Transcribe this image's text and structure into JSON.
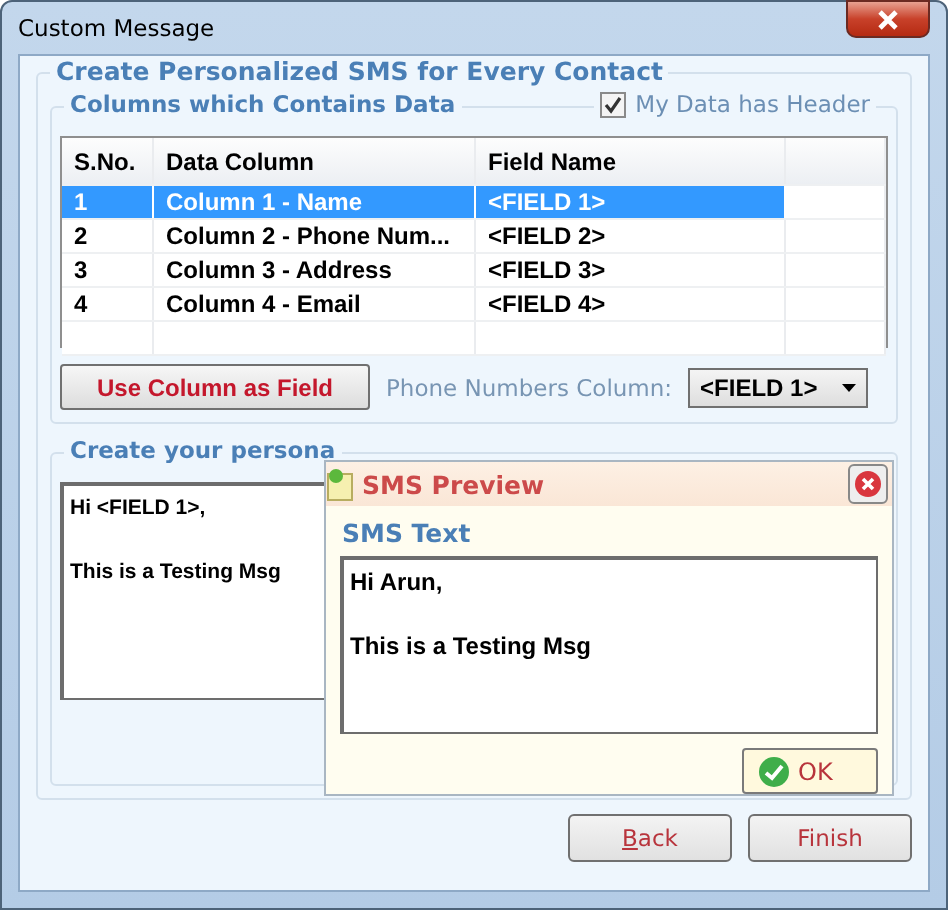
{
  "window": {
    "title": "Custom Message"
  },
  "main_group": {
    "title": "Create Personalized SMS for Every Contact"
  },
  "columns_group": {
    "title": "Columns which Contains Data",
    "header_checkbox": {
      "label": "My Data has Header",
      "checked": true
    }
  },
  "table": {
    "columns": [
      "S.No.",
      "Data Column",
      "Field Name"
    ],
    "rows": [
      {
        "cells": [
          "1",
          "Column 1 - Name",
          "<FIELD 1>"
        ],
        "selected": true
      },
      {
        "cells": [
          "2",
          "Column 2 - Phone Num...",
          "<FIELD 2>"
        ],
        "selected": false
      },
      {
        "cells": [
          "3",
          "Column 3 - Address",
          "<FIELD 3>"
        ],
        "selected": false
      },
      {
        "cells": [
          "4",
          "Column 4 - Email",
          "<FIELD 4>"
        ],
        "selected": false
      }
    ]
  },
  "use_column_button": "Use Column as Field",
  "phone_column": {
    "label": "Phone Numbers Column:",
    "value": "<FIELD 1>"
  },
  "message_group": {
    "title": "Create your persona",
    "text": "Hi <FIELD 1>,\n\nThis is a Testing Msg"
  },
  "preview": {
    "title": "SMS Preview",
    "label": "SMS Text",
    "text": "Hi Arun,\n\nThis is a Testing Msg",
    "ok": "OK"
  },
  "buttons": [
    {
      "label": "Back",
      "first_letter_underlined": true
    },
    {
      "label": "Finish"
    }
  ]
}
